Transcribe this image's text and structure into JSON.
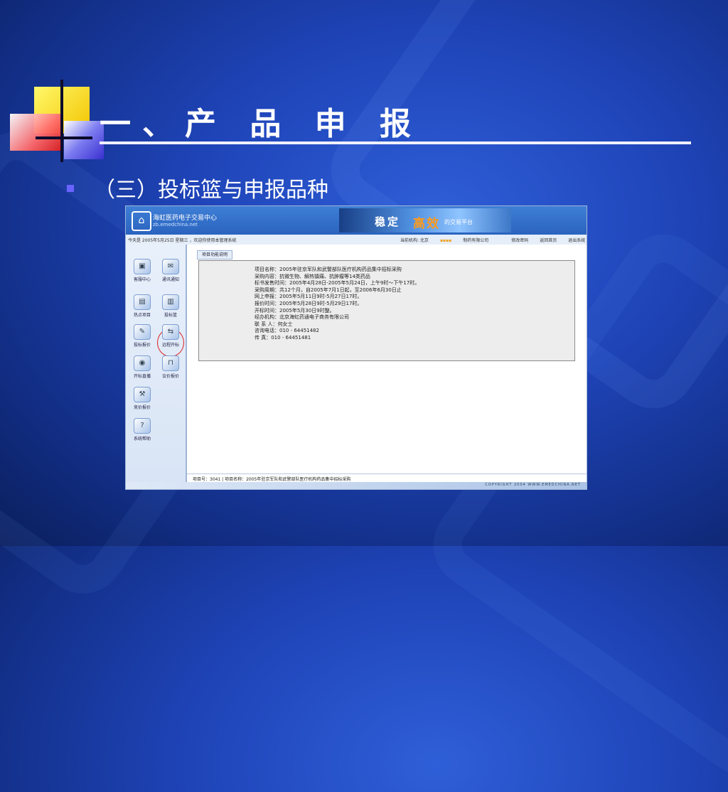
{
  "slide": {
    "title": "一、产 品 申 报",
    "subtitle": "（三）投标篮与申报品种"
  },
  "app": {
    "logo_name": "海虹医药电子交易中心",
    "logo_url": "zb.emedchina.net",
    "banner_part1": "稳定",
    "banner_part2": "高效",
    "banner_part3": "的交易平台"
  },
  "navbar": {
    "left_text": "今天是 2005年5月25日 星期三 ，欢迎你使用本管理系统",
    "org": "当前机构: 北京",
    "org_suffix": "制药有限公司",
    "links": [
      "修改密码",
      "返回首页",
      "退出系统"
    ]
  },
  "sidebar": {
    "items": [
      {
        "label": "客服中心"
      },
      {
        "label": "通讯通知"
      },
      {
        "label": "热点项目"
      },
      {
        "label": "投标篮"
      },
      {
        "label": "投标报价"
      },
      {
        "label": "远程开标"
      },
      {
        "label": "开标直播"
      },
      {
        "label": "议价报价"
      },
      {
        "label": "竞价报价"
      },
      {
        "label": "系统帮助"
      }
    ]
  },
  "main": {
    "tab_label": "项目功能说明",
    "info_lines": [
      "项目名称：2005年驻京军队和武警部队医疗机构药品集中招标采购",
      "采购内容：抗微生物、解热镇痛、抗肿瘤等14类药品",
      "标书发售时间：2005年4月28日-2005年5月24日，上午9时～下午17时。",
      "采购周期：共12个月，自2005年7月1日起，至2006年6月30日止",
      "网上申报：2005年5月11日9时-5月27日17时。",
      "报价时间：2005年5月28日9时-5月29日17时。",
      "开标时间：2005年5月30日9时整。",
      "经办机构：北京海虹药通电子商务有限公司",
      "联 系 人：何女士",
      "咨询电话：010 - 64451482",
      "传 真：010 - 64451481"
    ]
  },
  "footer": {
    "text": "项目号：3041 | 项目名称：2005年驻京军队和武警部队医疗机构药品集中招标采购",
    "copyright": "COPYRIGHT 2004 WWW.EMEDCHINA.NET"
  }
}
